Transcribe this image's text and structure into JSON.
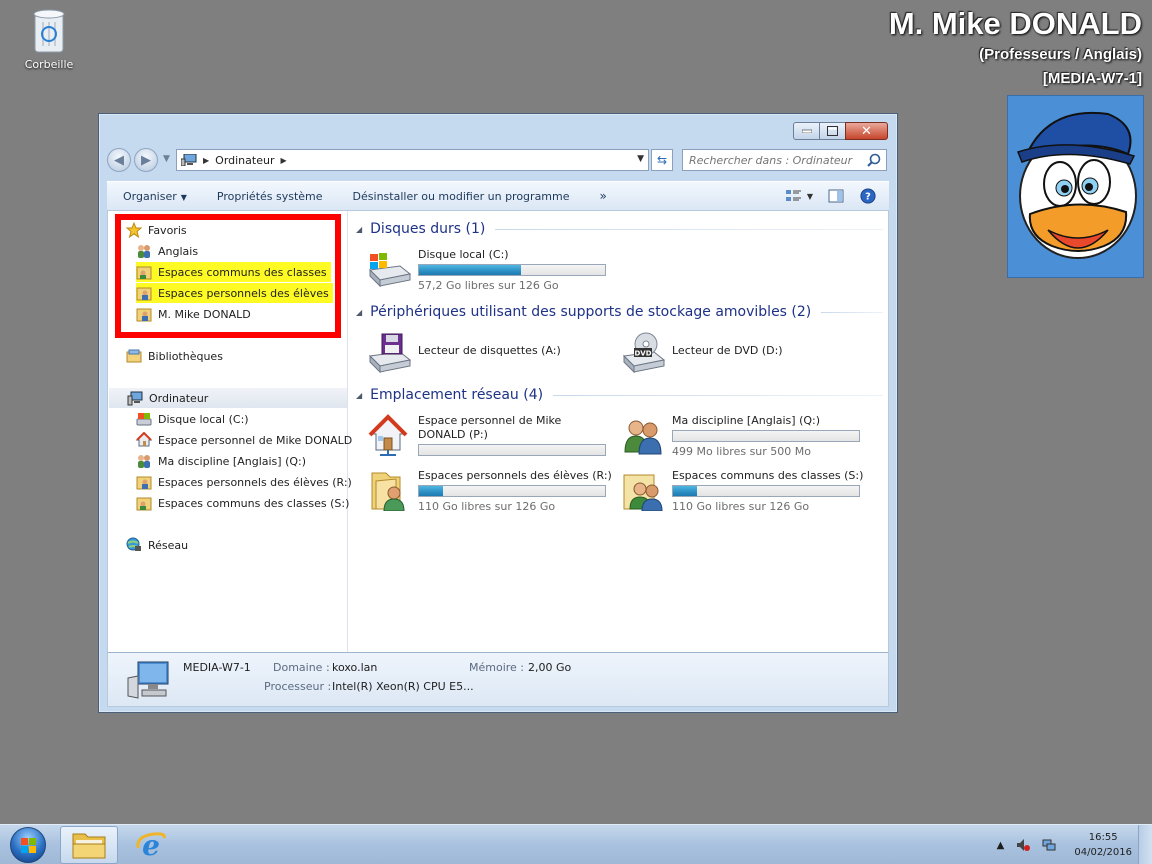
{
  "desktop": {
    "recycle_bin_label": "Corbeille",
    "overlay": {
      "user_name": "M. Mike DONALD",
      "role": "(Professeurs / Anglais)",
      "machine": "[MEDIA-W7-1]"
    }
  },
  "window": {
    "address": {
      "crumb": "Ordinateur"
    },
    "search": {
      "placeholder": "Rechercher dans : Ordinateur"
    },
    "command_bar": {
      "organize": "Organiser",
      "system_properties": "Propriétés système",
      "uninstall": "Désinstaller ou modifier un programme",
      "more": "»"
    },
    "nav_pane": {
      "favorites": "Favoris",
      "fav_items": [
        "Anglais",
        "Espaces communs des classes",
        "Espaces personnels des élèves",
        "M. Mike DONALD"
      ],
      "libraries": "Bibliothèques",
      "computer": "Ordinateur",
      "computer_items": [
        "Disque local (C:)",
        "Espace personnel de Mike DONALD",
        "Ma discipline [Anglais] (Q:)",
        "Espaces personnels des élèves (R:)",
        "Espaces communs des classes (S:)"
      ],
      "network": "Réseau"
    },
    "groups": {
      "hard_disks": {
        "title": "Disques durs (1)",
        "drives": [
          {
            "name": "Disque local (C:)",
            "free": "57,2 Go libres sur 126 Go",
            "used_fraction": 0.55
          }
        ]
      },
      "removable": {
        "title": "Périphériques utilisant des supports de stockage amovibles (2)",
        "drives": [
          {
            "name": "Lecteur de disquettes (A:)"
          },
          {
            "name": "Lecteur de DVD (D:)",
            "badge": "DVD"
          }
        ]
      },
      "network": {
        "title": "Emplacement réseau (4)",
        "drives": [
          {
            "name": "Espace personnel de Mike DONALD (P:)",
            "free": "",
            "used_fraction": 0.0
          },
          {
            "name": "Ma discipline [Anglais] (Q:)",
            "free": "499 Mo libres sur 500 Mo",
            "used_fraction": 0.0
          },
          {
            "name": "Espaces personnels des élèves (R:)",
            "free": "110 Go libres sur 126 Go",
            "used_fraction": 0.13
          },
          {
            "name": "Espaces communs des classes (S:)",
            "free": "110 Go libres sur 126 Go",
            "used_fraction": 0.13
          }
        ]
      }
    },
    "details": {
      "computer_name": "MEDIA-W7-1",
      "domain_label": "Domaine :",
      "domain_value": "koxo.lan",
      "memory_label": "Mémoire :",
      "memory_value": "2,00 Go",
      "processor_label": "Processeur :",
      "processor_value": "Intel(R) Xeon(R) CPU E5..."
    }
  },
  "taskbar": {
    "time": "16:55",
    "date": "04/02/2016"
  },
  "colors": {
    "desktop_bg": "#7f7f7f",
    "highlight": "#fefb24",
    "annotation_red": "#ff0000",
    "progress_fill": "#2c8fc4",
    "group_title": "#1e3287"
  }
}
